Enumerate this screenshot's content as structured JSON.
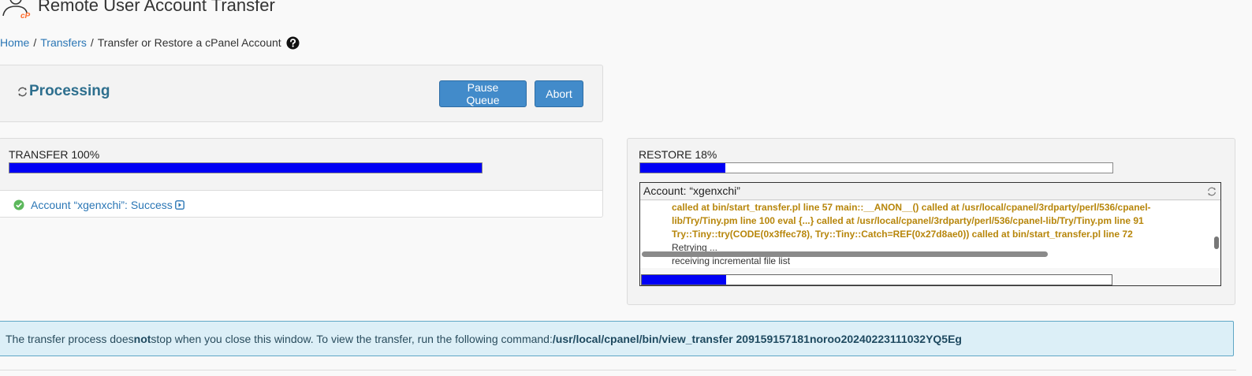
{
  "header": {
    "title": "Remote User Account Transfer"
  },
  "breadcrumb": {
    "home": "Home",
    "sep": "/",
    "transfers": "Transfers",
    "current": "Transfer or Restore a cPanel Account"
  },
  "status": {
    "label": "Processing",
    "pause_label": "Pause Queue",
    "abort_label": "Abort"
  },
  "transfer": {
    "label": "TRANSFER 100%",
    "progress": 1.0,
    "account_result": "Account “xgenxchi”: Success"
  },
  "restore": {
    "label": "RESTORE 18%",
    "progress": 0.18,
    "log_title": "Account: “xgenxchi”",
    "log_lines": [
      {
        "text": "called at bin/start_transfer.pl line 57 main::__ANON__() called at /usr/local/cpanel/3rdparty/perl/536/cpanel-",
        "kind": "err"
      },
      {
        "text": "lib/Try/Tiny.pm line 100 eval {...} called at /usr/local/cpanel/3rdparty/perl/536/cpanel-lib/Try/Tiny.pm line 91",
        "kind": "err"
      },
      {
        "text": "Try::Tiny::try(CODE(0x3ffec78), Try::Tiny::Catch=REF(0x27d8ae0)) called at bin/start_transfer.pl line 72",
        "kind": "err"
      },
      {
        "text": "Retrying ...",
        "kind": "info"
      },
      {
        "text": "receiving incremental file list",
        "kind": "info"
      }
    ],
    "log_progress": 0.18
  },
  "info": {
    "part1": "The transfer process does ",
    "bold": "not",
    "part2": " stop when you close this window. To view the transfer, run the following command: ",
    "command": "/usr/local/cpanel/bin/view_transfer 209159157181noroo20240223111032YQ5Eg"
  },
  "colors": {
    "accent": "#428bca",
    "link": "#2a76b5",
    "progress": "#0000f5",
    "log_error": "#b7860b",
    "info_bg": "#dceff7"
  }
}
